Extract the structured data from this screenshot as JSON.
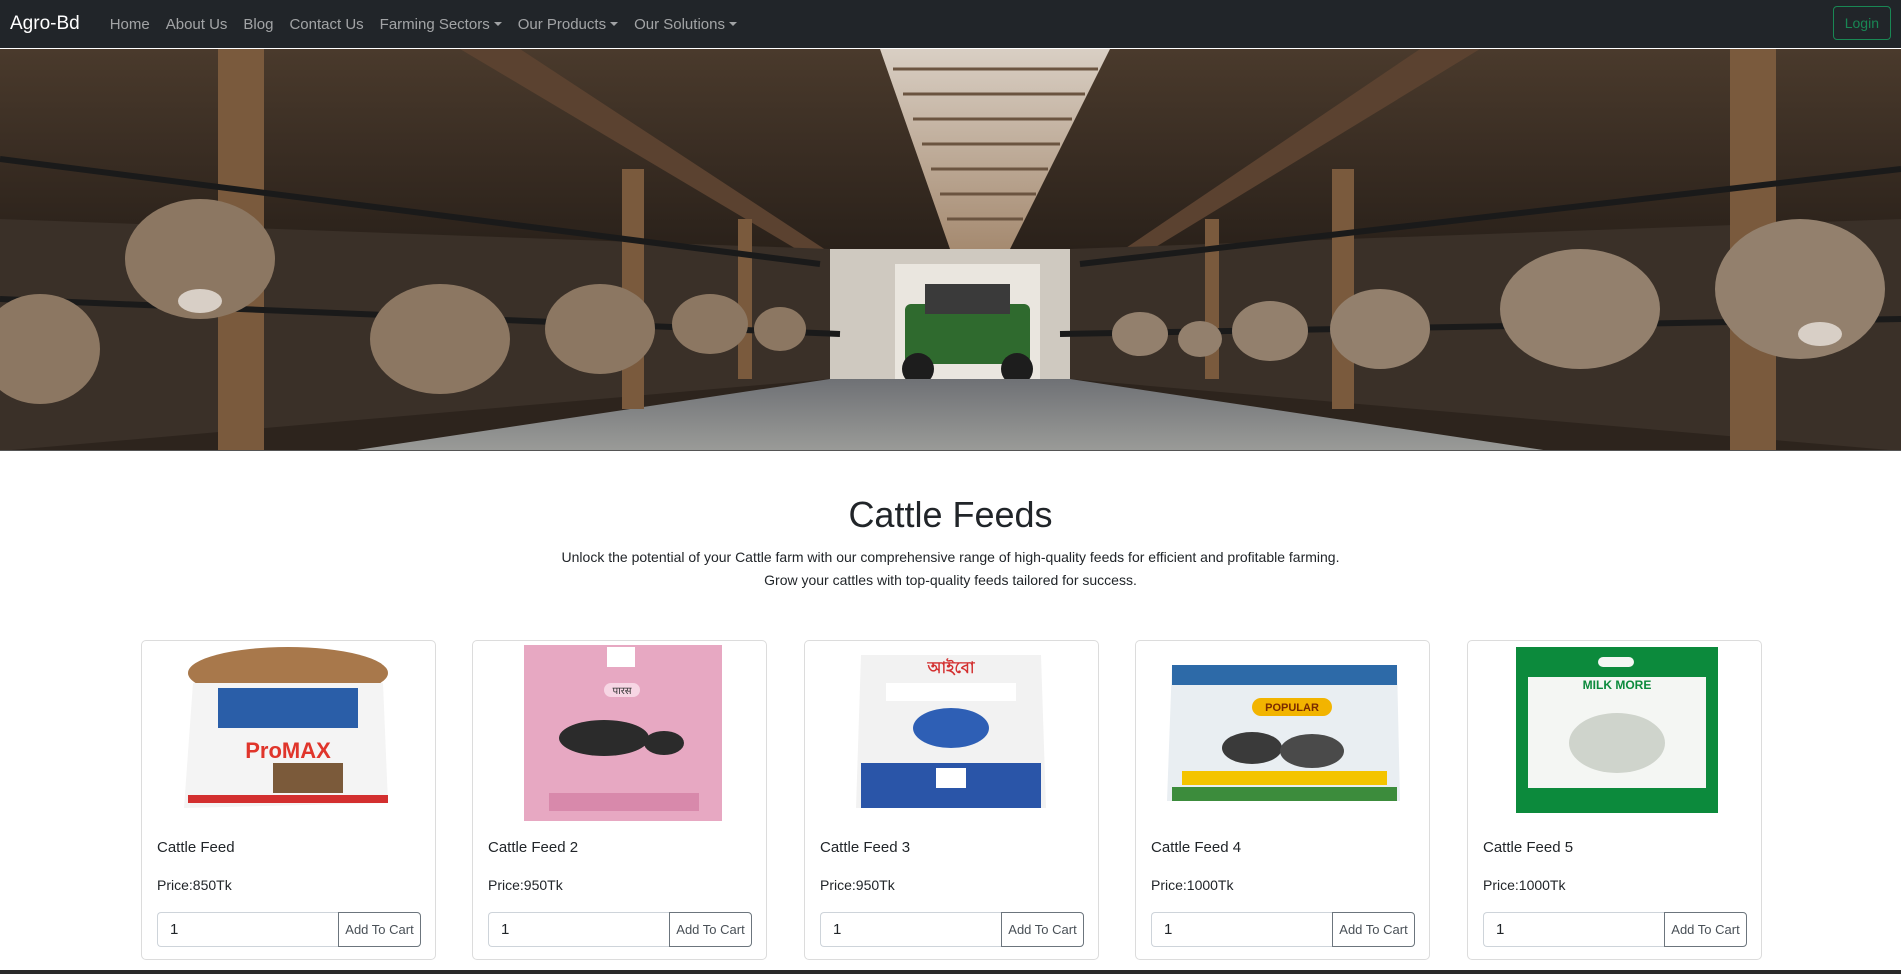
{
  "nav": {
    "brand": "Agro-Bd",
    "links": [
      "Home",
      "About Us",
      "Blog",
      "Contact Us"
    ],
    "dropdowns": [
      "Farming Sectors",
      "Our Products",
      "Our Solutions"
    ],
    "login": "Login"
  },
  "colors": {
    "navbar": "#212529",
    "accent": "#198754",
    "nav_text": "#9a9da0"
  },
  "section": {
    "title": "Cattle Feeds",
    "desc_line1": "Unlock the potential of your Cattle farm with our comprehensive range of high-quality feeds for efficient and profitable farming.",
    "desc_line2": "Grow your cattles with top-quality feeds tailored for success."
  },
  "products": [
    {
      "name": "Cattle Feed",
      "price": "Price:850Tk",
      "qty": "1",
      "button": "Add To Cart",
      "bag_brand": "ProMAX",
      "icon": "feed-bag-icon"
    },
    {
      "name": "Cattle Feed 2",
      "price": "Price:950Tk",
      "qty": "1",
      "button": "Add To Cart",
      "bag_brand": "पारस",
      "icon": "feed-bag-icon"
    },
    {
      "name": "Cattle Feed 3",
      "price": "Price:950Tk",
      "qty": "1",
      "button": "Add To Cart",
      "bag_brand": "আইবো",
      "icon": "feed-bag-icon"
    },
    {
      "name": "Cattle Feed 4",
      "price": "Price:1000Tk",
      "qty": "1",
      "button": "Add To Cart",
      "bag_brand": "POPULAR",
      "icon": "feed-bag-icon"
    },
    {
      "name": "Cattle Feed 5",
      "price": "Price:1000Tk",
      "qty": "1",
      "button": "Add To Cart",
      "bag_brand": "MILK MORE",
      "icon": "feed-bag-icon"
    }
  ]
}
